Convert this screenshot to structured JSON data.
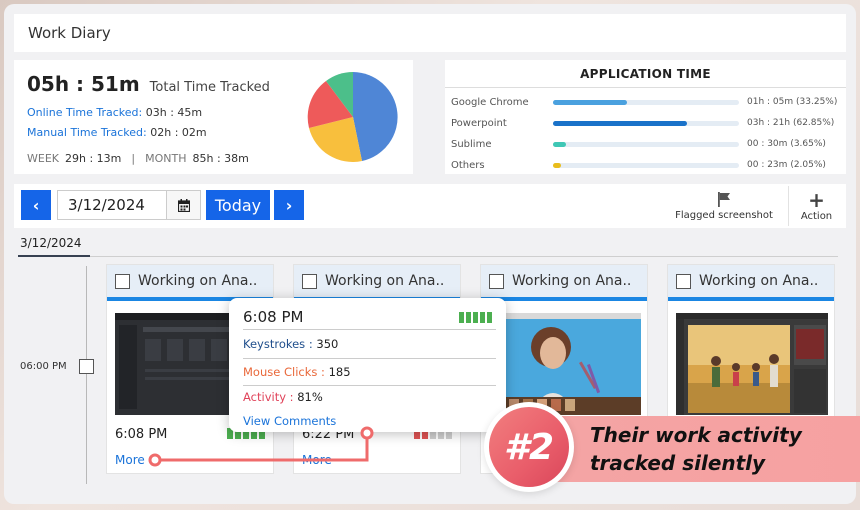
{
  "header": {
    "title": "Work Diary"
  },
  "summary": {
    "total_time": "05h : 51m",
    "total_label": "Total Time Tracked",
    "online_label": "Online Time Tracked:",
    "online_value": "03h : 45m",
    "manual_label": "Manual Time Tracked:",
    "manual_value": "02h : 02m",
    "week_label": "WEEK",
    "week_value": "29h : 13m",
    "separator": "|",
    "month_label": "MONTH",
    "month_value": "85h : 38m",
    "pie_colors": [
      "#4f86d6",
      "#f8bf3d",
      "#ee5a5a",
      "#4cbf8a"
    ]
  },
  "app_time": {
    "title": "APPLICATION TIME",
    "apps": [
      {
        "name": "Google Chrome",
        "time": "01h : 05m",
        "pct": "(33.25%)",
        "fraction": 0.4,
        "color": "#4aa1df"
      },
      {
        "name": "Powerpoint",
        "time": "03h : 21h",
        "pct": "(62.85%)",
        "fraction": 0.72,
        "color": "#1a72c9"
      },
      {
        "name": "Sublime",
        "time": "00 : 30m",
        "pct": "(3.65%)",
        "fraction": 0.07,
        "color": "#3fc7b5"
      },
      {
        "name": "Others",
        "time": "00 : 23m",
        "pct": "(2.05%)",
        "fraction": 0.045,
        "color": "#e9bd1c"
      }
    ]
  },
  "toolbar": {
    "prev_icon": "chevron-left-icon",
    "date_value": "3/12/2024",
    "calendar_icon": "calendar-icon",
    "today_label": "Today",
    "next_icon": "chevron-right-icon",
    "flagged_label": "Flagged screenshot",
    "action_label": "Action"
  },
  "date_tab": "3/12/2024",
  "timeline": {
    "time_label": "06:00 PM"
  },
  "cards": [
    {
      "title": "Working on Ana..",
      "time": "6:08 PM",
      "more": "More"
    },
    {
      "title": "Working on Ana..",
      "time": "6:22 PM",
      "more": "More"
    },
    {
      "title": "Working on Ana..",
      "time": "",
      "more": ""
    },
    {
      "title": "Working on Ana..",
      "time": "",
      "more": ""
    }
  ],
  "tooltip": {
    "time": "6:08 PM",
    "keystrokes_label": "Keystrokes :",
    "keystrokes_value": "350",
    "mouse_label": "Mouse Clicks :",
    "mouse_value": "185",
    "activity_label": "Activity :",
    "activity_value": "81%",
    "view_comments": "View Comments"
  },
  "promo": {
    "badge": "#2",
    "line1": "Their work activity",
    "line2": "tracked silently"
  }
}
